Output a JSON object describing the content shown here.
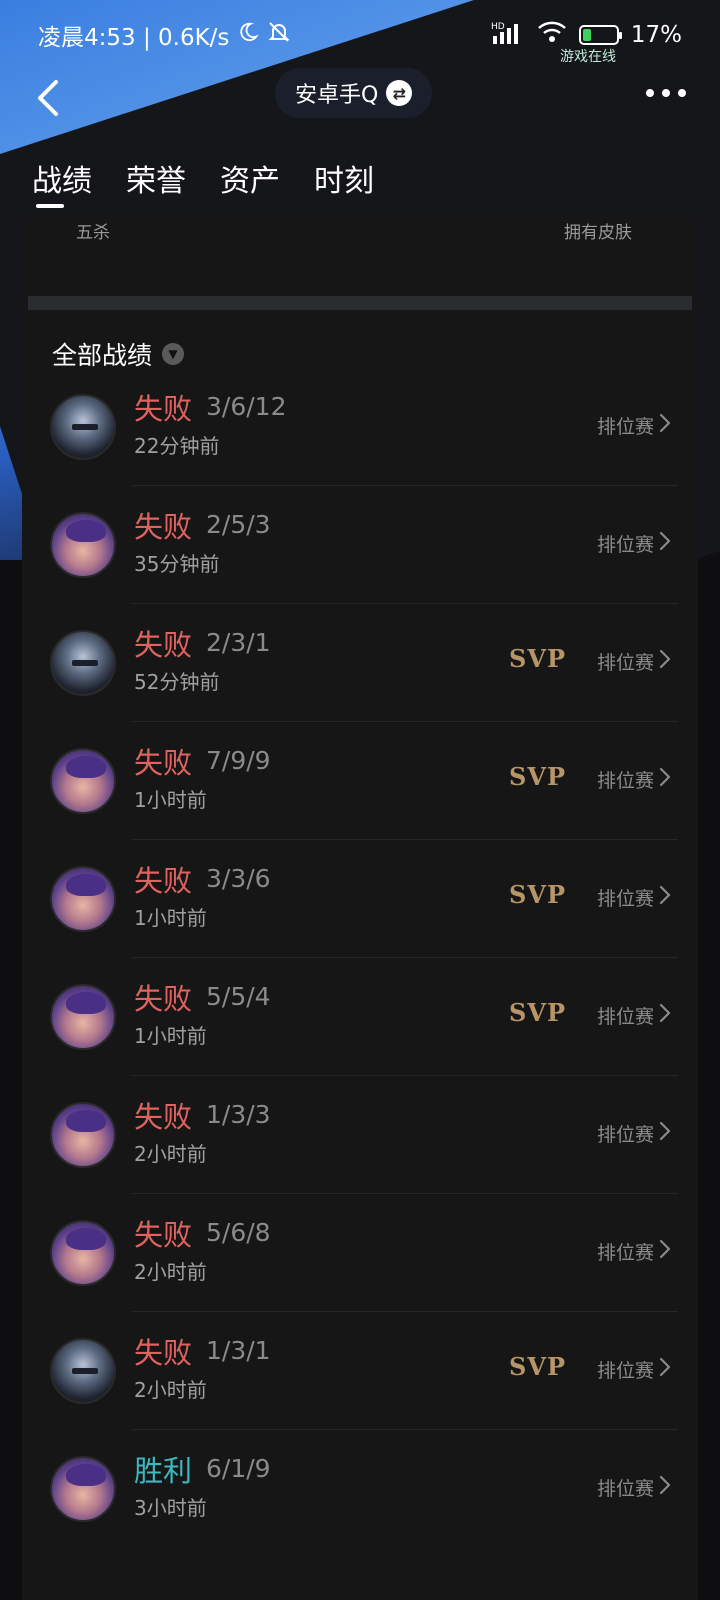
{
  "status_bar": {
    "left_text": "凌晨4:53 | 0.6K/s",
    "network_label": "HD",
    "battery": "17%",
    "sub_label": "游戏在线"
  },
  "header": {
    "account_name": "安卓手Q"
  },
  "tabs": [
    {
      "label": "战绩",
      "active": true
    },
    {
      "label": "荣誉",
      "active": false
    },
    {
      "label": "资产",
      "active": false
    },
    {
      "label": "时刻",
      "active": false
    }
  ],
  "top_stats": {
    "left_label": "五杀",
    "right_label": "拥有皮肤"
  },
  "filter": {
    "label": "全部战绩"
  },
  "matches": [
    {
      "avatar": "knight",
      "result": "失败",
      "result_type": "lose",
      "kda": "3/6/12",
      "time": "22分钟前",
      "svp": "",
      "mode": "排位赛"
    },
    {
      "avatar": "girl",
      "result": "失败",
      "result_type": "lose",
      "kda": "2/5/3",
      "time": "35分钟前",
      "svp": "",
      "mode": "排位赛"
    },
    {
      "avatar": "knight",
      "result": "失败",
      "result_type": "lose",
      "kda": "2/3/1",
      "time": "52分钟前",
      "svp": "SVP",
      "mode": "排位赛"
    },
    {
      "avatar": "girl",
      "result": "失败",
      "result_type": "lose",
      "kda": "7/9/9",
      "time": "1小时前",
      "svp": "SVP",
      "mode": "排位赛"
    },
    {
      "avatar": "girl",
      "result": "失败",
      "result_type": "lose",
      "kda": "3/3/6",
      "time": "1小时前",
      "svp": "SVP",
      "mode": "排位赛"
    },
    {
      "avatar": "girl",
      "result": "失败",
      "result_type": "lose",
      "kda": "5/5/4",
      "time": "1小时前",
      "svp": "SVP",
      "mode": "排位赛"
    },
    {
      "avatar": "girl",
      "result": "失败",
      "result_type": "lose",
      "kda": "1/3/3",
      "time": "2小时前",
      "svp": "",
      "mode": "排位赛"
    },
    {
      "avatar": "girl",
      "result": "失败",
      "result_type": "lose",
      "kda": "5/6/8",
      "time": "2小时前",
      "svp": "",
      "mode": "排位赛"
    },
    {
      "avatar": "knight",
      "result": "失败",
      "result_type": "lose",
      "kda": "1/3/1",
      "time": "2小时前",
      "svp": "SVP",
      "mode": "排位赛"
    },
    {
      "avatar": "girl",
      "result": "胜利",
      "result_type": "win",
      "kda": "6/1/9",
      "time": "3小时前",
      "svp": "",
      "mode": "排位赛"
    }
  ]
}
